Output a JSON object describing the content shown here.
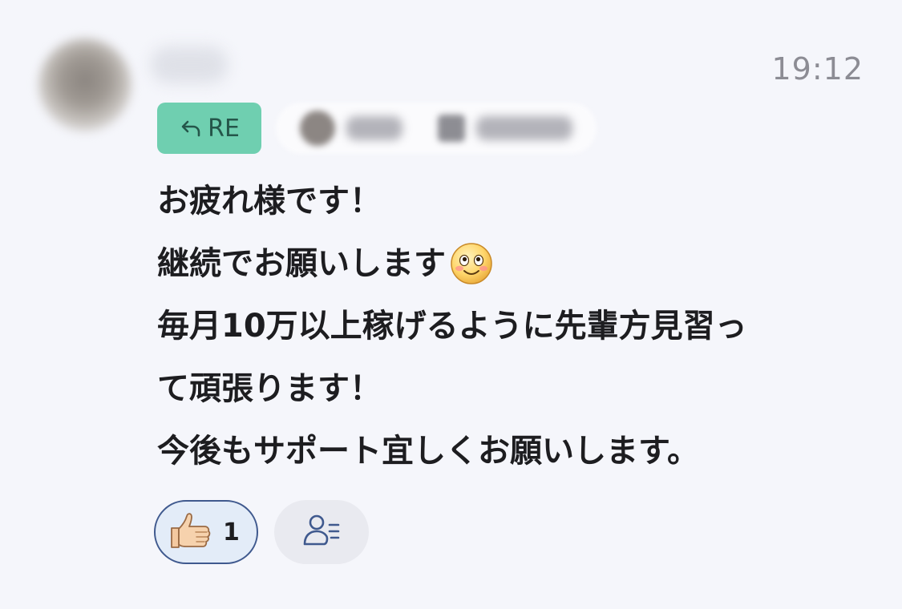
{
  "header": {
    "time": "19:12"
  },
  "reply": {
    "badge_label": "RE"
  },
  "message": {
    "lines": [
      "お疲れ様です！",
      "継続でお願いします",
      "毎月10万以上稼げるように先輩方見習っ",
      "て頑張ります！",
      "今後もサポート宜しくお願いします。"
    ]
  },
  "reactions": {
    "thumbs_up_count": "1"
  },
  "colors": {
    "re_badge": "#6fcfb0",
    "reaction_border": "#3f598e",
    "timestamp": "#8c8c94"
  }
}
